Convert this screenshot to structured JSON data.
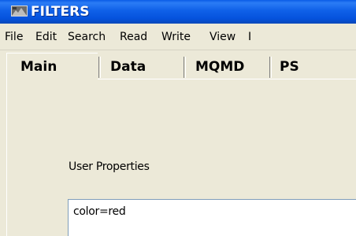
{
  "window": {
    "title": "FILTERS",
    "icon": "app-icon"
  },
  "menu": {
    "items": [
      "File",
      "Edit",
      "Search",
      "Read",
      "Write",
      "View",
      "I"
    ]
  },
  "tabs": [
    {
      "label": "Main",
      "active": true
    },
    {
      "label": "Data",
      "active": false
    },
    {
      "label": "MQMD",
      "active": false
    },
    {
      "label": "PS",
      "active": false
    }
  ],
  "main": {
    "user_properties_label": "User Properties",
    "user_properties_value": "color=red"
  },
  "colors": {
    "titlebar": "#0552dc",
    "window_bg": "#ece9d8",
    "field_border": "#7f9db9"
  }
}
